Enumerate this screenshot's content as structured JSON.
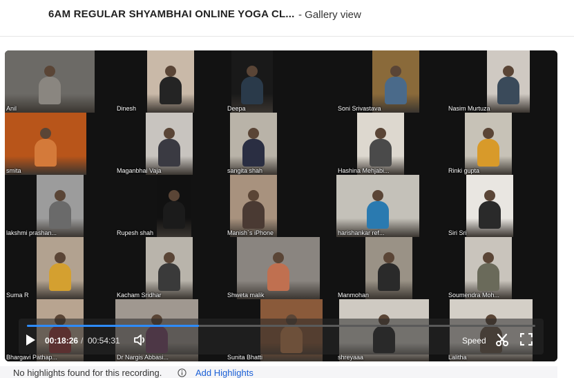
{
  "header": {
    "title": "6AM REGULAR SHYAMBHAI ONLINE YOGA CL...",
    "subtitle": "- Gallery view"
  },
  "participants": [
    {
      "name": "Anil",
      "bg": "#6c6a66",
      "fig": "#8a8680"
    },
    {
      "name": "Dinesh",
      "bg": "#c9b9a8",
      "fig": "#242424"
    },
    {
      "name": "Deepa",
      "bg": "#191919",
      "fig": "#2a3a4a"
    },
    {
      "name": "Soni Srivastava",
      "bg": "#8a6a3a",
      "fig": "#4a6a8a"
    },
    {
      "name": "Nasim Murtuza",
      "bg": "#cfc9c2",
      "fig": "#3a4a5a"
    },
    {
      "name": "smita",
      "bg": "#b8551a",
      "fig": "#d47a3a"
    },
    {
      "name": "Maganbhai Vaja",
      "bg": "#c8c4bf",
      "fig": "#3a3a42"
    },
    {
      "name": "sangita shah",
      "bg": "#b9b3a8",
      "fig": "#2a2e42"
    },
    {
      "name": "Hashina Mehjabi...",
      "bg": "#ddd8cf",
      "fig": "#4a4a4a"
    },
    {
      "name": "Rinki gupta",
      "bg": "#c7c2b7",
      "fig": "#d89a2a"
    },
    {
      "name": "lakshmi prashan...",
      "bg": "#9c9c9c",
      "fig": "#6a6a6a"
    },
    {
      "name": "Rupesh shah",
      "bg": "#111111",
      "fig": "#1b1b1b"
    },
    {
      "name": "Manish`s iPhone",
      "bg": "#a8927e",
      "fig": "#4a3a33"
    },
    {
      "name": "harishankar ref...",
      "bg": "#c4c1b9",
      "fig": "#2a7ab0"
    },
    {
      "name": "Siri Sri",
      "bg": "#e9e6e1",
      "fig": "#2a2a2a"
    },
    {
      "name": "Suma R",
      "bg": "#b2a290",
      "fig": "#d4a030"
    },
    {
      "name": "Kacham Sridhar",
      "bg": "#b9b4ab",
      "fig": "#3a3a3a"
    },
    {
      "name": "Shweta malik",
      "bg": "#8a8580",
      "fig": "#c07050"
    },
    {
      "name": "Manmohan",
      "bg": "#9a9286",
      "fig": "#2a2a2a"
    },
    {
      "name": "Soumendra Moh...",
      "bg": "#c9c4bc",
      "fig": "#6a6a5a"
    },
    {
      "name": "Bhargavi Pathap...",
      "bg": "#b8a490",
      "fig": "#9a3a3a"
    },
    {
      "name": "Dr Nargis Abbasi...",
      "bg": "#a09890",
      "fig": "#7a4a6a"
    },
    {
      "name": "Sunita Bhatti",
      "bg": "#8a5a3a",
      "fig": "#c08050"
    },
    {
      "name": "shreyaaa",
      "bg": "#cfcac2",
      "fig": "#2a2a2a"
    },
    {
      "name": "Lalitha",
      "bg": "#d4cfc7",
      "fig": "#6a5a4a"
    }
  ],
  "controls": {
    "current_time": "00:18:26",
    "separator": "/",
    "total_time": "00:54:31",
    "progress_fraction": 0.338,
    "speed_label": "Speed"
  },
  "highlights": {
    "message": "No highlights found for this recording.",
    "link_label": "Add Highlights"
  },
  "colors": {
    "accent": "#2d8cff",
    "link": "#1a5fd6"
  },
  "icons": {
    "play": "play-icon",
    "volume": "volume-icon",
    "clip": "scissors-icon",
    "fullscreen": "fullscreen-icon",
    "info": "info-icon"
  }
}
